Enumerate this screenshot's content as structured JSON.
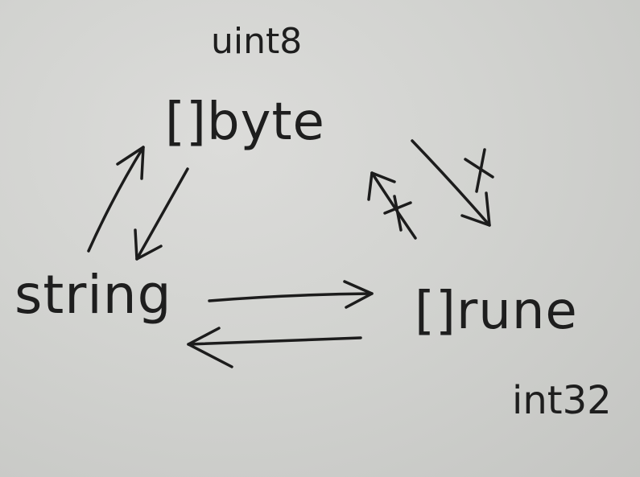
{
  "nodes": {
    "byte_slice": {
      "label": "[]byte",
      "type_annotation": "uint8"
    },
    "string": {
      "label": "string"
    },
    "rune_slice": {
      "label": "[]rune",
      "type_annotation": "int32"
    }
  },
  "edges": [
    {
      "from": "string",
      "to": "byte_slice",
      "crossed": false
    },
    {
      "from": "byte_slice",
      "to": "string",
      "crossed": false
    },
    {
      "from": "string",
      "to": "rune_slice",
      "crossed": false
    },
    {
      "from": "rune_slice",
      "to": "string",
      "crossed": false
    },
    {
      "from": "byte_slice",
      "to": "rune_slice",
      "crossed": true
    },
    {
      "from": "rune_slice",
      "to": "byte_slice",
      "crossed": true
    }
  ]
}
